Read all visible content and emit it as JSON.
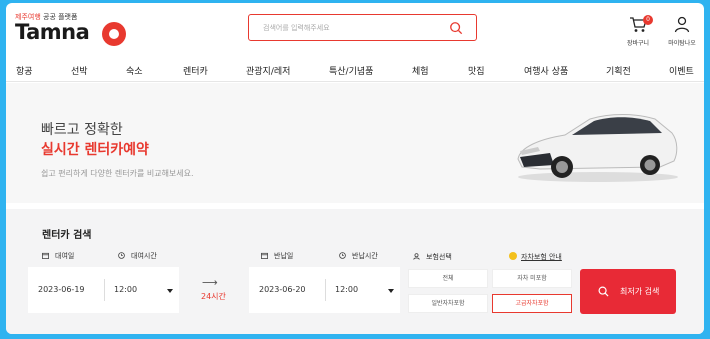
{
  "header": {
    "logo_sub_accent": "제주여행",
    "logo_sub_rest": "공공 플랫폼",
    "logo_text": "Tamna",
    "search_placeholder": "검색어를 입력해주세요",
    "cart_label": "장바구니",
    "cart_count": "0",
    "mypage_label": "마이탐나오"
  },
  "nav": {
    "items": [
      "항공",
      "선박",
      "숙소",
      "렌터카",
      "관광지/레저",
      "특산/기념품",
      "체험",
      "맛집",
      "여행사 상품",
      "기획전",
      "이벤트"
    ]
  },
  "hero": {
    "line1": "빠르고 정확한",
    "line2": "실시간 렌터카예약",
    "line3": "쉽고 편리하게 다양한 렌터카를 비교해보세요."
  },
  "booking": {
    "title": "렌터카 검색",
    "pickup_date_label": "대여일",
    "pickup_time_label": "대여시간",
    "pickup_date": "2023-06-19",
    "pickup_time": "12:00",
    "duration": "24시간",
    "return_date_label": "반납일",
    "return_time_label": "반납시간",
    "return_date": "2023-06-20",
    "return_time": "12:00",
    "insurance_label": "보험선택",
    "insurance_info": "자차보험 안내",
    "insurance_options": [
      "전체",
      "자차 미포함",
      "일반자차포함",
      "고급자차포함"
    ],
    "search_button": "최저가 검색"
  },
  "colors": {
    "accent": "#e8392f",
    "search_button": "#e82a36",
    "frame": "#2fb3f0"
  }
}
